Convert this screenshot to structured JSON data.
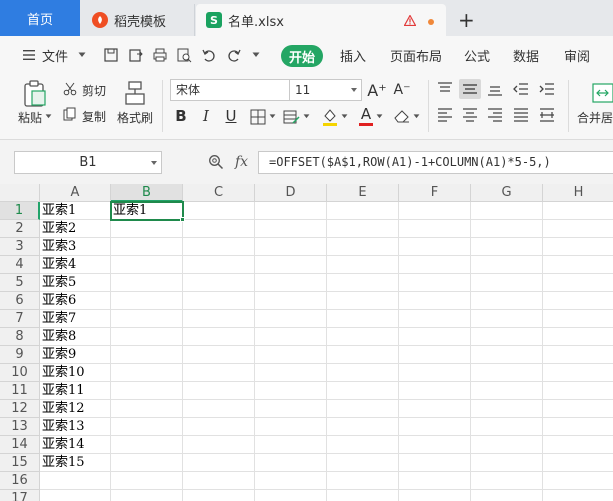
{
  "tabs": {
    "home": "首页",
    "templates": "稻壳模板",
    "file": "名单.xlsx",
    "new_tab_glyph": "+"
  },
  "menu": {
    "file": "文件",
    "items": [
      "开始",
      "插入",
      "页面布局",
      "公式",
      "数据",
      "审阅"
    ]
  },
  "ribbon": {
    "paste": "粘贴",
    "cut": "剪切",
    "copy": "复制",
    "format_painter": "格式刷",
    "font_name": "宋体",
    "font_size": "11",
    "bold": "B",
    "italic": "I",
    "underline": "U",
    "grow_font": "A⁺",
    "shrink_font": "A⁻",
    "font_color_glyph": "A",
    "merge_center": "合并居"
  },
  "formula_bar": {
    "name_box": "B1",
    "fx": "fx",
    "formula": "=OFFSET($A$1,ROW(A1)-1+COLUMN(A1)*5-5,)"
  },
  "sheet": {
    "columns": [
      "A",
      "B",
      "C",
      "D",
      "E",
      "F",
      "G",
      "H"
    ],
    "rows": [
      "1",
      "2",
      "3",
      "4",
      "5",
      "6",
      "7",
      "8",
      "9",
      "10",
      "11",
      "12",
      "13",
      "14",
      "15",
      "16",
      "17"
    ],
    "selected_column": "B",
    "selected_row": "1",
    "col_a": [
      "亚索1",
      "亚索2",
      "亚索3",
      "亚索4",
      "亚索5",
      "亚索6",
      "亚索7",
      "亚索8",
      "亚索9",
      "亚索10",
      "亚索11",
      "亚索12",
      "亚索13",
      "亚索14",
      "亚索15",
      "",
      ""
    ],
    "col_b": [
      "亚索1",
      "",
      "",
      "",
      "",
      "",
      "",
      "",
      "",
      "",
      "",
      "",
      "",
      "",
      "",
      "",
      ""
    ]
  },
  "colors": {
    "accent_green": "#24a664",
    "home_tab_blue": "#2f7de1",
    "selection_green": "#1f8a4c"
  }
}
